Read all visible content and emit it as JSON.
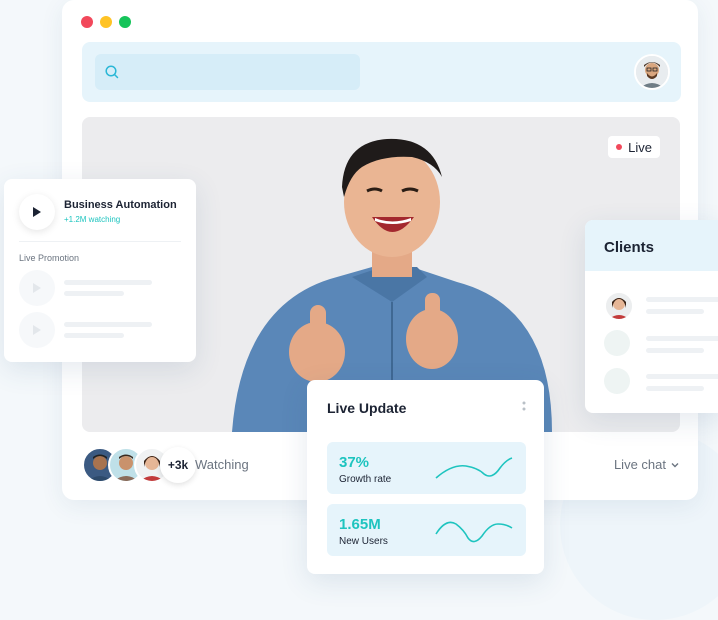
{
  "window": {
    "traffic_lights": {
      "close": "#f2485b",
      "minimize": "#ffc325",
      "maximize": "#16c45a"
    }
  },
  "search": {
    "icon": "search-icon"
  },
  "video": {
    "live_label": "Live"
  },
  "bottom_bar": {
    "viewer_count": "+3k",
    "watching_label": "Watching",
    "live_chat_label": "Live chat"
  },
  "left_panel": {
    "title": "Business Automation",
    "subtitle": "+1.2M watching",
    "section_label": "Live Promotion"
  },
  "clients_panel": {
    "title": "Clients"
  },
  "live_update": {
    "title": "Live Update",
    "metrics": [
      {
        "value": "37%",
        "label": "Growth rate"
      },
      {
        "value": "1.65M",
        "label": "New Users"
      }
    ]
  },
  "colors": {
    "accent": "#1ec4bf",
    "panel_bg": "#e6f4fb",
    "live_dot": "#f2485b",
    "dark": "#1c2333"
  }
}
